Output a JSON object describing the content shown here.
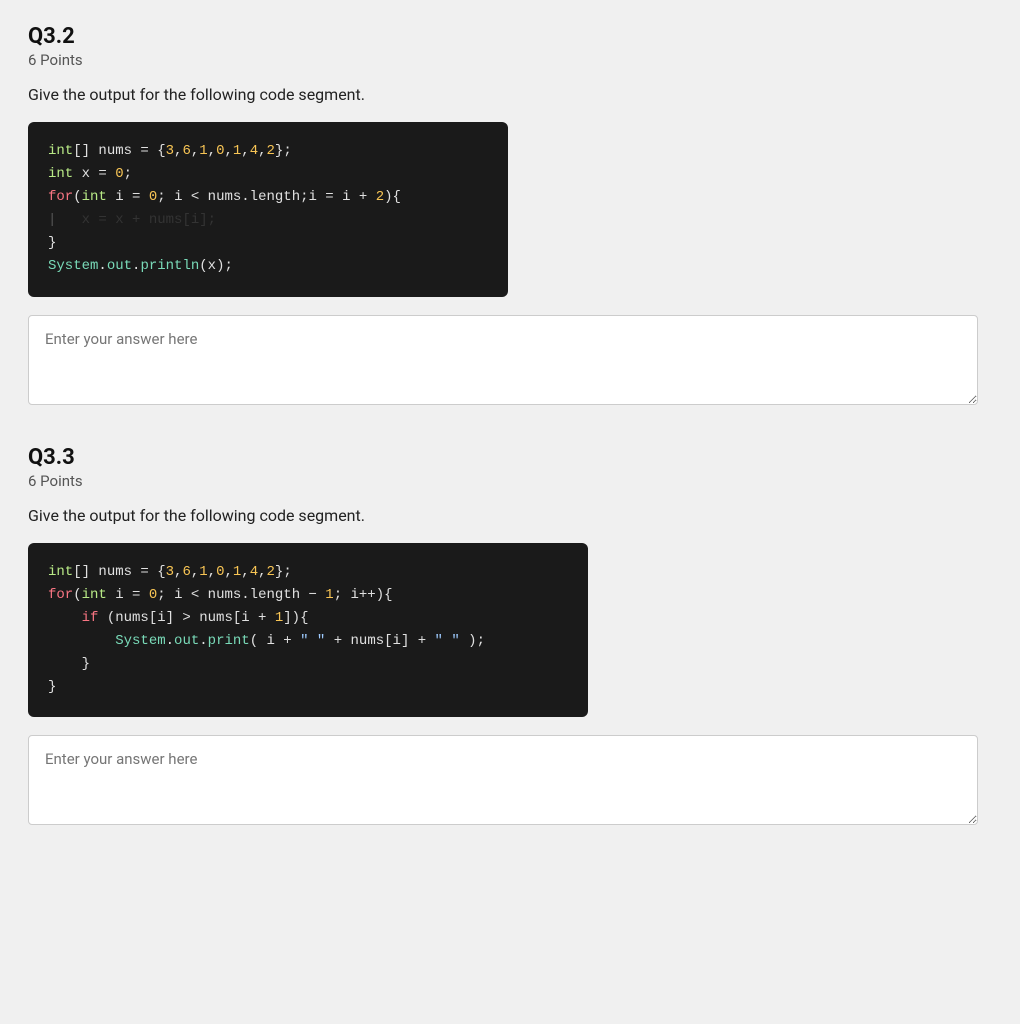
{
  "q32": {
    "title": "Q3.2",
    "points": "6 Points",
    "prompt": "Give the output for the following code segment.",
    "answer_placeholder": "Enter your answer here"
  },
  "q33": {
    "title": "Q3.3",
    "points": "6 Points",
    "prompt": "Give the output for the following code segment.",
    "answer_placeholder": "Enter your answer here"
  }
}
